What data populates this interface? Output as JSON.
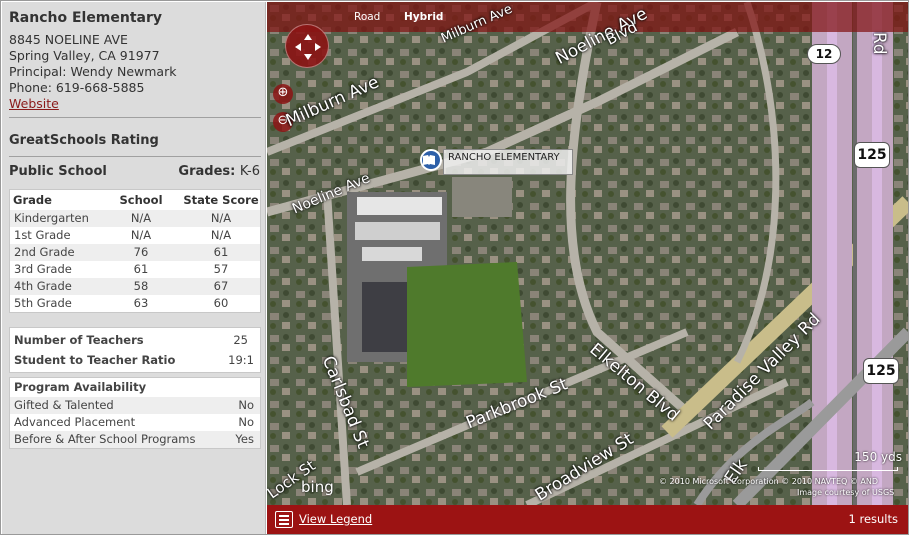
{
  "school": {
    "name": "Rancho Elementary",
    "address1": "8845 NOELINE AVE",
    "address2": "Spring Valley, CA 91977",
    "principal": "Principal: Wendy Newmark",
    "phone": "Phone: 619-668-5885",
    "website_label": "Website"
  },
  "rating": {
    "title": "GreatSchools Rating",
    "school_type": "Public School",
    "grades_label": "Grades:",
    "grades_value": "K-6"
  },
  "scores": {
    "headers": [
      "Grade",
      "School Score",
      "State Score"
    ],
    "rows": [
      [
        "Kindergarten",
        "N/A",
        "N/A"
      ],
      [
        "1st Grade",
        "N/A",
        "N/A"
      ],
      [
        "2nd Grade",
        "76",
        "61"
      ],
      [
        "3rd Grade",
        "61",
        "57"
      ],
      [
        "4th Grade",
        "58",
        "67"
      ],
      [
        "5th Grade",
        "63",
        "60"
      ]
    ]
  },
  "teachers": {
    "count_label": "Number of Teachers",
    "count_value": "25",
    "ratio_label": "Student to Teacher Ratio",
    "ratio_value": "19:1"
  },
  "programs": {
    "title": "Program Availability",
    "rows": [
      [
        "Gifted & Talented",
        "No"
      ],
      [
        "Advanced Placement",
        "No"
      ],
      [
        "Before & After School Programs",
        "Yes"
      ]
    ]
  },
  "map": {
    "mode_road": "Road",
    "mode_hybrid": "Hybrid",
    "pin_label": "RANCHO ELEMENTARY",
    "streets": {
      "noeline_top": "Noeline Ave",
      "noeline_left": "Noeline Ave",
      "milburn": "Milburn Ave",
      "milburn_top": "Milburn Ave",
      "carlsbad": "Carlsbad St",
      "parkbrook": "Parkbrook St",
      "elkelton": "Elkelton Blvd",
      "broadview": "Broadview St",
      "paradise": "Paradise Valley Rd",
      "blvd_top": "Blvd",
      "rd_right": "Rd",
      "elkelton_bottom": "Elk",
      "lock": "Lock St"
    },
    "shields": [
      "12",
      "125",
      "125"
    ],
    "scale": "150 yds",
    "copyright1": "© 2010 Microsoft Corporation   © 2010 NAVTEQ   © AND",
    "copyright2": "Image courtesy of USGS",
    "logo": "bing"
  },
  "footer": {
    "legend_link": "View Legend",
    "results": "1 results"
  },
  "colors": {
    "brand_red": "#9c1313",
    "link_red": "#8b1a1a",
    "sidebar_bg": "#dcdcdc"
  }
}
